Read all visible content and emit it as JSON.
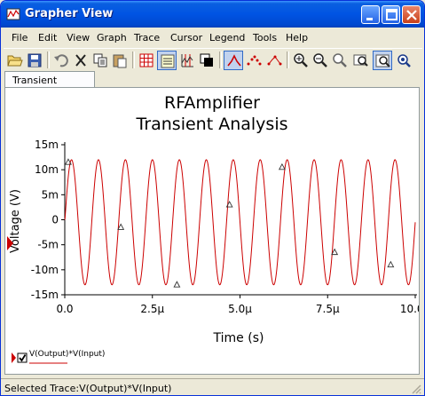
{
  "window": {
    "title": "Grapher View"
  },
  "menu": [
    "File",
    "Edit",
    "View",
    "Graph",
    "Trace",
    "Cursor",
    "Legend",
    "Tools",
    "Help"
  ],
  "toolbar_icons": [
    "open-icon",
    "save-icon",
    "undo-icon",
    "cut-icon",
    "copy-icon",
    "paste-icon",
    "grid-icon",
    "legend-icon",
    "cursors-icon",
    "reverse-colors-icon",
    "select-mark-icon",
    "show-dots-icon",
    "show-dots-lines-icon",
    "zoom-in-icon",
    "zoom-out-icon",
    "zoom-area-icon",
    "zoom-full-icon",
    "zoom-select-icon",
    "zoom-extra-icon"
  ],
  "tab": {
    "label": "Transient Analysis"
  },
  "chart_data": {
    "type": "line",
    "title": "RFAmplifier",
    "subtitle": "Transient Analysis",
    "xlabel": "Time (s)",
    "ylabel": "Voltage (V)",
    "xlim": [
      0,
      10.0
    ],
    "x_unit": "µs",
    "ylim": [
      -15,
      15
    ],
    "y_unit": "m",
    "x_ticks": [
      "0.0",
      "2.5µ",
      "5.0µ",
      "7.5µ",
      "10.0µ"
    ],
    "y_ticks": [
      "15m",
      "10m",
      "5m",
      "0",
      "-5m",
      "-10m",
      "-15m"
    ],
    "grid": false,
    "legend": "bottom-left",
    "series": [
      {
        "name": "V(Output)*V(Input)",
        "color": "#cc0000",
        "marker": "triangle",
        "amplitude_mV": 12.5,
        "offset_mV": -0.5,
        "cycles": 13,
        "markers_x_us": [
          0.1,
          1.6,
          3.2,
          4.7,
          6.2,
          7.7,
          9.3
        ],
        "markers_y_mV": [
          11.5,
          -1.5,
          -13,
          3,
          10.5,
          -6.5,
          -9
        ]
      }
    ]
  },
  "legend": {
    "entry": "V(Output)*V(Input)",
    "checked": true
  },
  "status": {
    "text": "Selected Trace:V(Output)*V(Input)"
  }
}
